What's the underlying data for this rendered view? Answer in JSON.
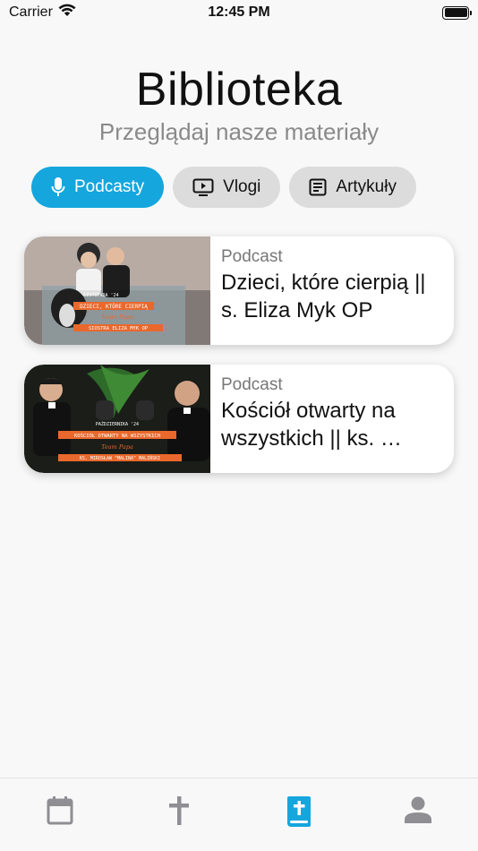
{
  "status_bar": {
    "carrier": "Carrier",
    "time": "12:45 PM",
    "wifi_icon": "wifi-icon",
    "battery_icon": "battery-icon",
    "battery_level": 1.0
  },
  "header": {
    "title": "Biblioteka",
    "subtitle": "Przeglądaj nasze materiały"
  },
  "tabs": [
    {
      "label": "Podcasty",
      "icon": "microphone-icon",
      "active": true
    },
    {
      "label": "Vlogi",
      "icon": "video-icon",
      "active": false
    },
    {
      "label": "Artykuły",
      "icon": "article-icon",
      "active": false
    }
  ],
  "items": [
    {
      "type": "Podcast",
      "title": "Dzieci, które cierpią || s. Eliza Myk OP",
      "thumbnail": {
        "caption_top": "LISTOPADA '24",
        "caption_main": "DZIECI, KTÓRE CIERPIĄ",
        "brand": "Team Papa",
        "caption_bottom": "SIOSTRA ELIZA MYK OP"
      }
    },
    {
      "type": "Podcast",
      "title": "Kościół otwarty na wszystkich || ks. …",
      "thumbnail": {
        "caption_top": "PAŹDZIERNIKA '24",
        "caption_main": "KOŚCIÓŁ OTWARTY NA WSZYSTKICH",
        "brand": "Team Papa",
        "caption_bottom": "KS. MIROSŁAW \"MALINA\" MALIŃSKI"
      }
    }
  ],
  "tabbar": {
    "items": [
      {
        "icon": "calendar-icon",
        "active": false
      },
      {
        "icon": "cross-icon",
        "active": false
      },
      {
        "icon": "bible-icon",
        "active": true
      },
      {
        "icon": "person-icon",
        "active": false
      }
    ]
  },
  "colors": {
    "accent": "#15a6dd",
    "inactive_tab_bg": "#dcdcdc",
    "inactive_icon": "#8e8e93",
    "background": "#f8f8f8"
  }
}
